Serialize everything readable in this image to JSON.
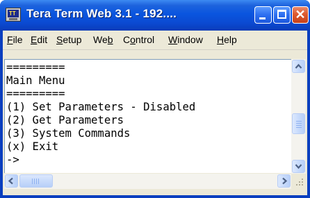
{
  "window": {
    "title": "Tera Term Web 3.1 - 192....",
    "icon": "tera-term-app-icon",
    "icon_text": "TT",
    "title_color": "#0a55df"
  },
  "menubar": {
    "items": [
      {
        "label": "File",
        "mnemonic": "F"
      },
      {
        "label": "Edit",
        "mnemonic": "E"
      },
      {
        "label": "Setup",
        "mnemonic": "S"
      },
      {
        "label": "Web",
        "mnemonic": "b"
      },
      {
        "label": "Control",
        "mnemonic": "o"
      },
      {
        "label": "Window",
        "mnemonic": "W"
      },
      {
        "label": "Help",
        "mnemonic": "H"
      }
    ]
  },
  "terminal": {
    "lines": [
      "=========",
      "Main Menu",
      "=========",
      "(1) Set Parameters - Disabled",
      "(2) Get Parameters",
      "(3) System Commands",
      "(x) Exit",
      "->"
    ]
  },
  "controls": {
    "minimize_icon": "minimize-icon",
    "maximize_icon": "maximize-icon",
    "close_icon": "close-icon",
    "close_glyph": "✕"
  }
}
